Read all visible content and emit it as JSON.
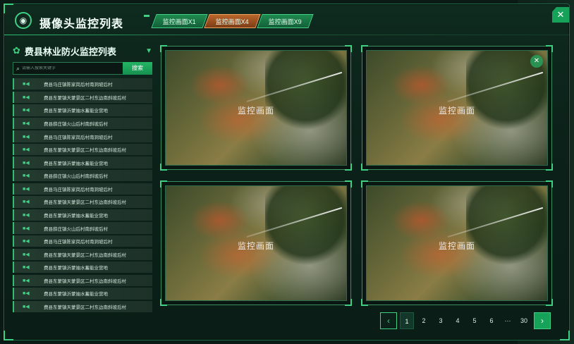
{
  "header": {
    "title": "摄像头监控列表",
    "tabs": [
      {
        "label": "监控画面X1",
        "active": false
      },
      {
        "label": "监控画面X4",
        "active": true
      },
      {
        "label": "监控画面X9",
        "active": false
      }
    ],
    "close_label": "✕"
  },
  "sidebar": {
    "title": "费县林业防火监控列表",
    "search_placeholder": "请输入搜索关键字",
    "search_button": "搜索",
    "items": [
      {
        "label": "费县马庄镇陈家岗后村南洞坡后村"
      },
      {
        "label": "费县东蒙镇天蒙景区二村东边南斜坡后村"
      },
      {
        "label": "费县东蒙镇沂蒙抽水蓄能业营地"
      },
      {
        "label": "费县薛庄镇火山后村南斜坡后村"
      },
      {
        "label": "费县马庄镇陈家岗后村南洞坡后村"
      },
      {
        "label": "费县东蒙镇天蒙景区二村东边南斜坡后村"
      },
      {
        "label": "费县东蒙镇沂蒙抽水蓄能业营地"
      },
      {
        "label": "费县薛庄镇火山后村南斜坡后村"
      },
      {
        "label": "费县马庄镇陈家岗后村南洞坡后村"
      },
      {
        "label": "费县东蒙镇天蒙景区二村东边南斜坡后村"
      },
      {
        "label": "费县东蒙镇沂蒙抽水蓄能业营地"
      },
      {
        "label": "费县薛庄镇火山后村南斜坡后村"
      },
      {
        "label": "费县马庄镇陈家岗后村南洞坡后村"
      },
      {
        "label": "费县东蒙镇天蒙景区二村东边南斜坡后村"
      },
      {
        "label": "费县东蒙镇沂蒙抽水蓄能业营地"
      },
      {
        "label": "费县东蒙镇天蒙景区二村东边南斜坡后村"
      },
      {
        "label": "费县东蒙镇沂蒙抽水蓄能业营地"
      },
      {
        "label": "费县东蒙镇天蒙景区二村东边南斜坡后村"
      }
    ]
  },
  "feeds": [
    {
      "caption": "监控画面"
    },
    {
      "caption": "监控画面"
    },
    {
      "caption": "监控画面"
    },
    {
      "caption": "监控画面"
    }
  ],
  "pagination": {
    "pages": [
      "1",
      "2",
      "3",
      "4",
      "5",
      "6"
    ],
    "ellipsis": "···",
    "last": "30",
    "current": "1"
  },
  "colors": {
    "accent": "#3fd083",
    "active_tab": "#b9652a",
    "panel_bg": "#0b2119"
  }
}
